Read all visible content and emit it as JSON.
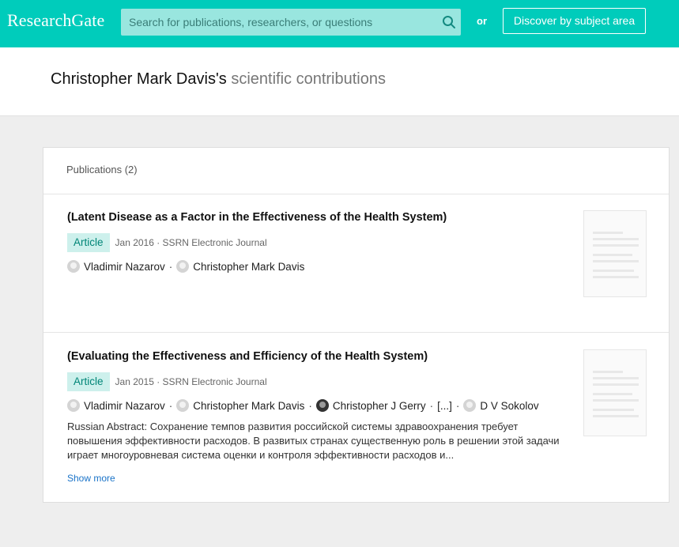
{
  "topbar": {
    "logo": "ResearchGate",
    "search_placeholder": "Search for publications, researchers, or questions",
    "or_label": "or",
    "discover_label": "Discover by subject area"
  },
  "header": {
    "name": "Christopher Mark Davis's",
    "suffix": " scientific contributions"
  },
  "publications": {
    "count_label": "Publications (2)",
    "items": [
      {
        "title": "(Latent Disease as a Factor in the Effectiveness of the Health System)",
        "type": "Article",
        "meta": "Jan 2016 · SSRN Electronic Journal",
        "authors": [
          "Vladimir Nazarov",
          "Christopher Mark Davis"
        ]
      },
      {
        "title": "(Evaluating the Effectiveness and Efficiency of the Health System)",
        "type": "Article",
        "meta": "Jan 2015 · SSRN Electronic Journal",
        "authors": [
          "Vladimir Nazarov",
          "Christopher Mark Davis",
          "Christopher J Gerry",
          "[...]",
          "D V Sokolov"
        ],
        "abstract": "Russian Abstract: Сохранение темпов развития российской системы здравоохранения требует повышения эффективности расходов. В развитых странах существенную роль в решении этой задачи играет многоуровневая система оценки и контроля эффективности расходов и...",
        "show_more": "Show more"
      }
    ]
  }
}
